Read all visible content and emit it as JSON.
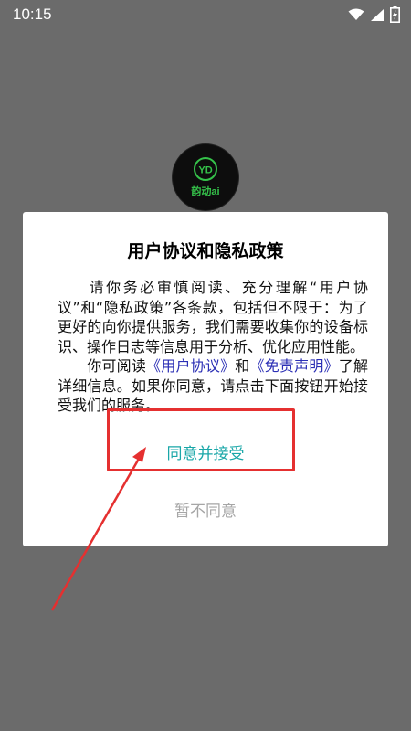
{
  "status_bar": {
    "time": "10:15",
    "icons": [
      "wifi-icon",
      "signal-icon",
      "battery-charging-icon"
    ]
  },
  "logo": {
    "mark": "YD",
    "label": "韵动ai"
  },
  "dialog": {
    "title": "用户协议和隐私政策",
    "para1": "请你务必审慎阅读、充分理解“用户协议”和“隐私政策”各条款，包括但不限于：为了更好的向你提供服务，我们需要收集你的设备标识、操作日志等信息用于分析、优化应用性能。",
    "para2_prefix": "你可阅读",
    "link_user_agreement": "《用户协议》",
    "para2_and": "和",
    "link_disclaimer": "《免责声明》",
    "para2_suffix": "了解详细信息。如果你同意，请点击下面按钮开始接受我们的服务。",
    "agree_label": "同意并接受",
    "decline_label": "暂不同意"
  },
  "colors": {
    "overlay": "#6b6b6b",
    "link": "#2b2fb5",
    "agree": "#1aa7a8",
    "decline": "#a6a6a6",
    "annotation": "#e53030",
    "logo_green": "#35c24a"
  }
}
